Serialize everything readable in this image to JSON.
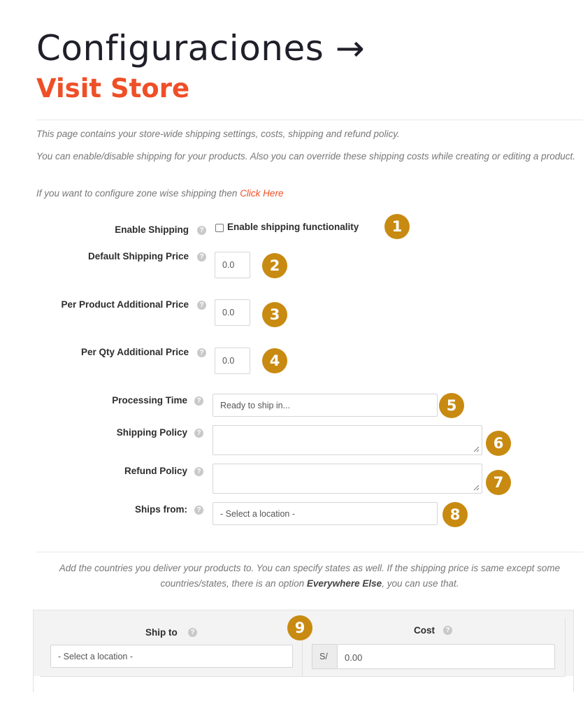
{
  "header": {
    "title": "Configuraciones",
    "title_arrow": "→",
    "visit_store": "Visit Store"
  },
  "intro": {
    "line1": "This page contains your store-wide shipping settings, costs, shipping and refund policy.",
    "line2": "You can enable/disable shipping for your products. Also you can override these shipping costs while creating or editing a product.",
    "line3_prefix": "If you want to configure zone wise shipping then ",
    "line3_link": "Click Here"
  },
  "fields": {
    "enable_shipping": {
      "label": "Enable Shipping",
      "checkbox_label": "Enable shipping functionality",
      "checked": false
    },
    "default_price": {
      "label": "Default Shipping Price",
      "value": "0.0"
    },
    "per_product": {
      "label": "Per Product Additional Price",
      "value": "0.0"
    },
    "per_qty": {
      "label": "Per Qty Additional Price",
      "value": "0.0"
    },
    "processing_time": {
      "label": "Processing Time",
      "value": "Ready to ship in..."
    },
    "shipping_policy": {
      "label": "Shipping Policy",
      "value": ""
    },
    "refund_policy": {
      "label": "Refund Policy",
      "value": ""
    },
    "ships_from": {
      "label": "Ships from:",
      "value": "- Select a location -"
    }
  },
  "note": {
    "part1": "Add the countries you deliver your products to. You can specify states as well. If the shipping price is same except some countries/states, there is an option ",
    "emphasis": "Everywhere Else",
    "part2": ", you can use that."
  },
  "table": {
    "ship_to_header": "Ship to",
    "cost_header": "Cost",
    "ship_to_value": "- Select a location -",
    "currency": "S/",
    "cost_value": "0.00"
  },
  "help_glyph": "?",
  "badges": [
    "1",
    "2",
    "3",
    "4",
    "5",
    "6",
    "7",
    "8",
    "9"
  ],
  "colors": {
    "accent": "#ef4f27",
    "badge": "#c88a10",
    "title": "#1f1f2a"
  }
}
